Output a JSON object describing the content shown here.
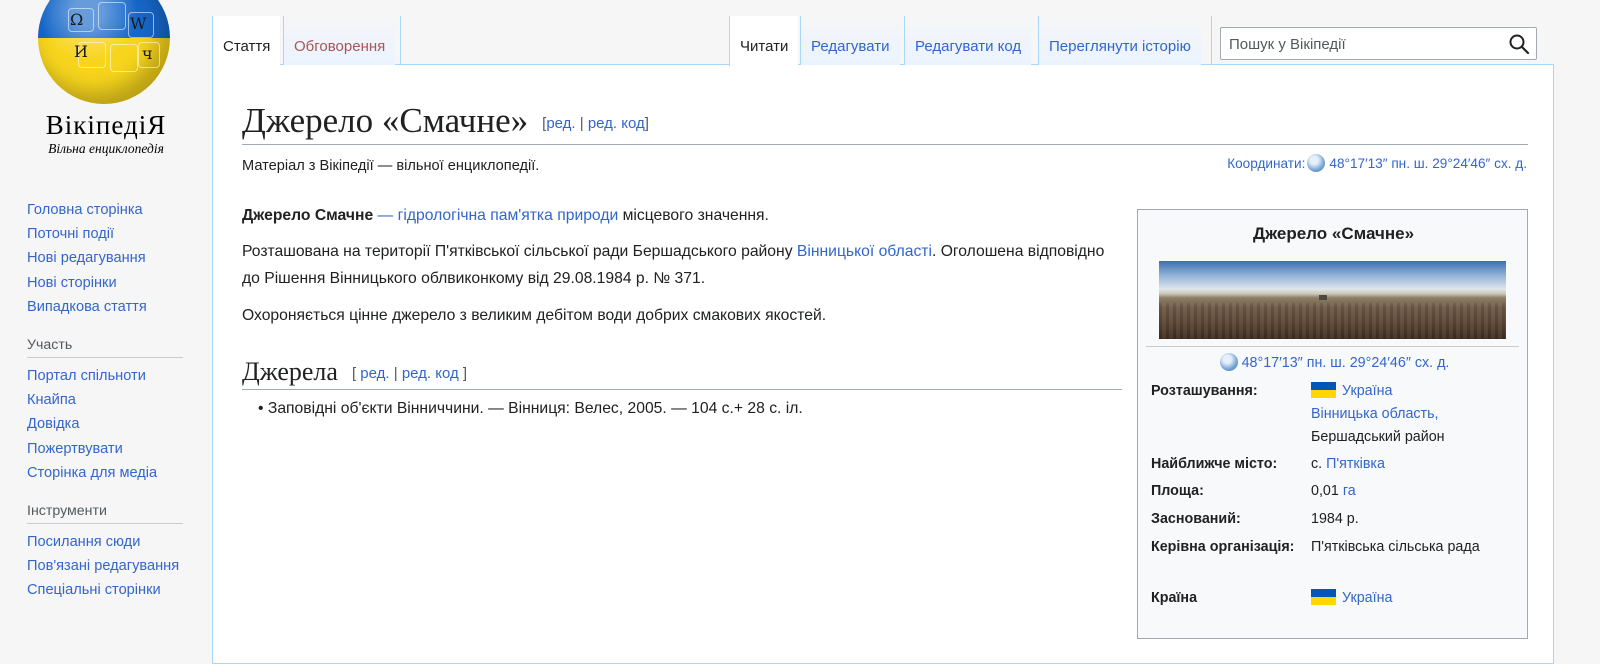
{
  "logo": {
    "wordmark": "ВікіпедіЯ",
    "tagline": "Вільна енциклопедія"
  },
  "sidebar": {
    "nav": [
      "Головна сторінка",
      "Поточні події",
      "Нові редагування",
      "Нові сторінки",
      "Випадкова стаття"
    ],
    "participation_head": "Участь",
    "participation": [
      "Портал спільноти",
      "Кнайпа",
      "Довідка",
      "Пожертвувати",
      "Сторінка для медіа"
    ],
    "tools_head": "Інструменти",
    "tools": [
      "Посилання сюди",
      "Пов'язані редагування",
      "Спеціальні сторінки"
    ]
  },
  "tabs": {
    "article": "Стаття",
    "talk": "Обговорення",
    "read": "Читати",
    "edit": "Редагувати",
    "edit_source": "Редагувати код",
    "history": "Переглянути історію"
  },
  "search": {
    "placeholder": "Пошук у Вікіпедії"
  },
  "page": {
    "title": "Джерело «Смачне»",
    "edit_open": "[",
    "edit": "ред.",
    "edit_sep": " | ",
    "edit_source": "ред. код",
    "edit_close": "]",
    "site_sub": "Матеріал з Вікіпедії — вільної енциклопедії.",
    "coords_label": "Координати:",
    "coords": "48°17′13″ пн. ш. 29°24′46″ сх. д.",
    "p1_bold": "Джерело Смачне",
    "p1_dash": " — ",
    "p1_link": "гідрологічна пам'ятка природи",
    "p1_rest": " місцевого значення.",
    "p2_a": "Розташована на території П'ятківської сільської ради Бершадського району ",
    "p2_link": "Вінницької області",
    "p2_b": ". Оголошена відповідно до Рішення Вінницького облвиконкому від 29.08.1984 р. № 371.",
    "p3": "Охороняється цінне джерело з великим дебітом води добрих смакових якостей.",
    "section_title": "Джерела",
    "sect_edit_open": "[ ",
    "sect_edit_close": " ]",
    "ref_bullet": "•",
    "ref1": "Заповідні об'єкти Вінниччини. — Вінниця: Велес, 2005. — 104 с.+ 28 с. іл."
  },
  "infobox": {
    "title": "Джерело «Смачне»",
    "coords": "48°17′13″ пн. ш. 29°24′46″ сх. д.",
    "rows": {
      "location_label": "Розташування:",
      "location_country": "Україна",
      "location_region": "Вінницька область,",
      "location_district": "Бершадський район",
      "nearest_label": "Найближче місто:",
      "nearest_prefix": "с. ",
      "nearest_link": "П'ятківка",
      "area_label": "Площа:",
      "area_value": "0,01 ",
      "area_unit": "га",
      "founded_label": "Заснований:",
      "founded_value": "1984 р.",
      "org_label": "Керівна організація:",
      "org_value": "П'ятківська сільська рада",
      "country_label": "Країна",
      "country_value": "Україна"
    }
  },
  "colors": {
    "link": "#3366cc",
    "text": "#202122",
    "tab_border": "#a7d7f9",
    "infobox_bg": "#f8f9fa",
    "flag_blue": "#0057b7",
    "flag_yellow": "#ffd700"
  }
}
